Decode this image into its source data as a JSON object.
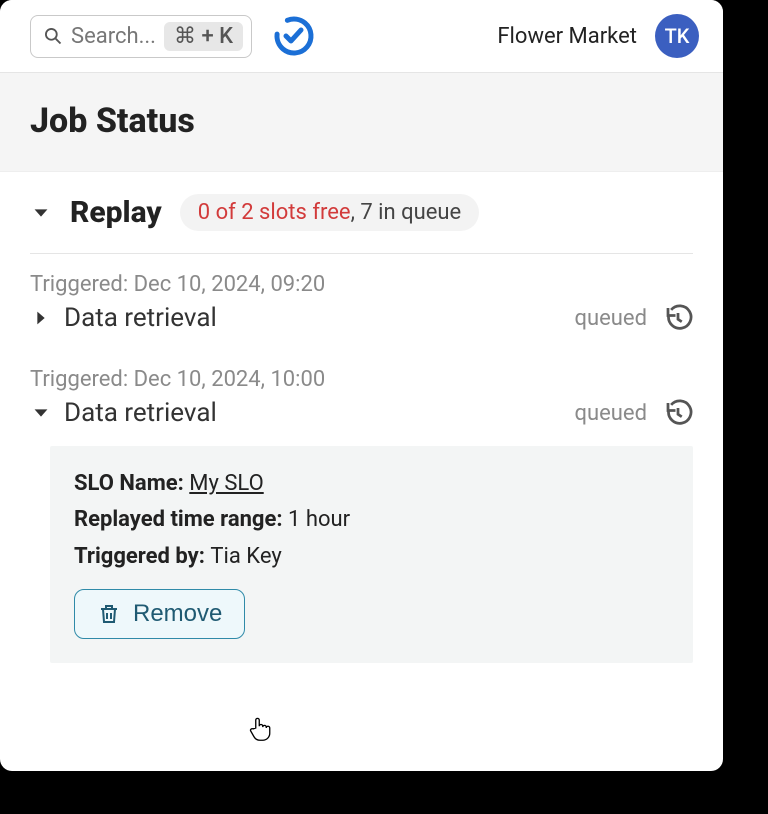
{
  "header": {
    "search_placeholder": "Search...",
    "shortcut": "⌘ + K",
    "org_name": "Flower Market",
    "avatar_initials": "TK"
  },
  "page": {
    "title": "Job Status"
  },
  "section": {
    "title": "Replay",
    "slots_text": "0 of 2 slots free",
    "queue_text": ", 7 in queue"
  },
  "jobs": [
    {
      "triggered_label": "Triggered: ",
      "triggered_at": "Dec 10, 2024, 09:20",
      "name": "Data retrieval",
      "status": "queued",
      "expanded": false
    },
    {
      "triggered_label": "Triggered: ",
      "triggered_at": "Dec 10, 2024, 10:00",
      "name": "Data retrieval",
      "status": "queued",
      "expanded": true,
      "details": {
        "slo_label": "SLO Name: ",
        "slo_value": "My SLO",
        "range_label": "Replayed time range: ",
        "range_value": "1 hour",
        "by_label": "Triggered by: ",
        "by_value": "Tia Key",
        "remove_label": "Remove"
      }
    }
  ]
}
